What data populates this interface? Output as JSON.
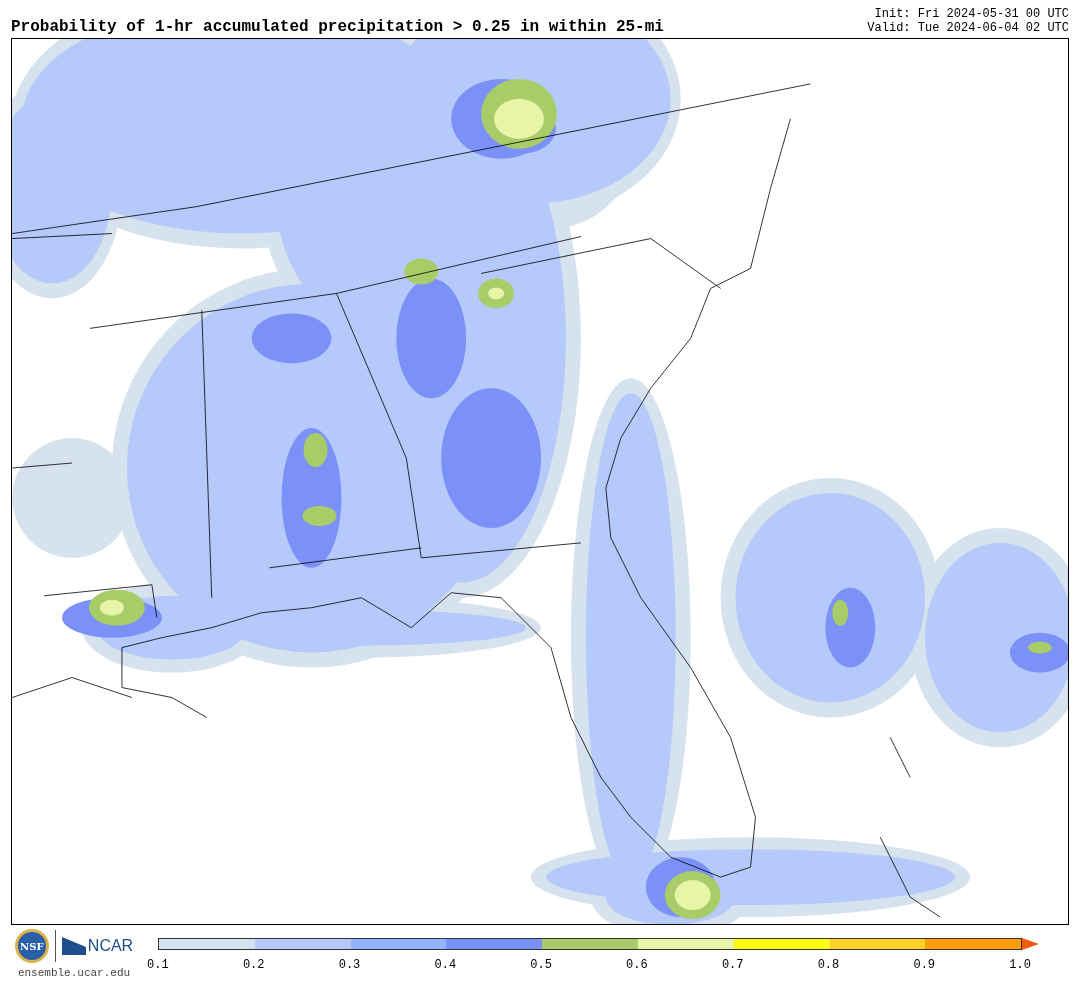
{
  "title": "Probability of 1-hr accumulated precipitation > 0.25 in within 25-mi",
  "init": "Init: Fri 2024-05-31 00 UTC",
  "valid": "Valid: Tue 2024-06-04 02 UTC",
  "logos": {
    "nsf": "NSF",
    "ncar": "NCAR",
    "site": "ensemble.ucar.edu"
  },
  "colorbar": {
    "segments": [
      {
        "color": "#d6e2ed"
      },
      {
        "color": "#b5c9fb"
      },
      {
        "color": "#97b2fb"
      },
      {
        "color": "#7b91f8"
      },
      {
        "color": "#a8cc68"
      },
      {
        "color": "#e8f5a8"
      },
      {
        "color": "#fdfb14"
      },
      {
        "color": "#fdd226"
      },
      {
        "color": "#fb9e0a"
      },
      {
        "kind": "arrow",
        "color": "#f05a0c"
      }
    ],
    "ticks": [
      "0.1",
      "0.2",
      "0.3",
      "0.4",
      "0.5",
      "0.6",
      "0.7",
      "0.8",
      "0.9",
      "1.0"
    ]
  }
}
